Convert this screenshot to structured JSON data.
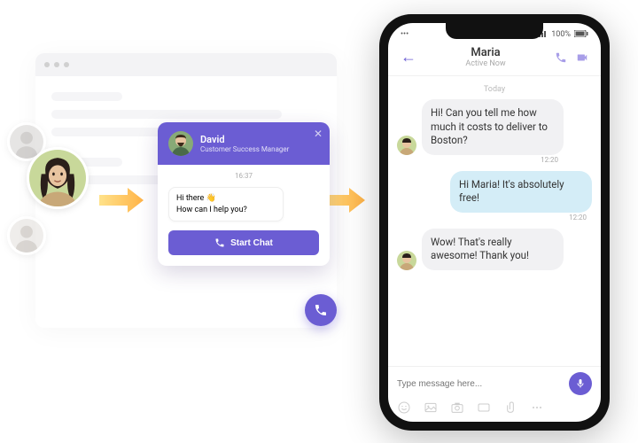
{
  "widget": {
    "agent_name": "David",
    "agent_title": "Customer Success Manager",
    "timestamp": "16:37",
    "greeting_line1": "Hi there 👋",
    "greeting_line2": "How can I help you?",
    "start_button": "Start Chat"
  },
  "phone": {
    "status_left": "•••",
    "status_signal": "📶",
    "status_battery": "100%",
    "contact_name": "Maria",
    "contact_status": "Active Now",
    "day_label": "Today",
    "messages": [
      {
        "dir": "in",
        "text": "Hi! Can you tell me how much it costs to deliver to Boston?",
        "time": "12:20"
      },
      {
        "dir": "out",
        "text": "Hi Maria! It's absolutely free!",
        "time": "12:20"
      },
      {
        "dir": "in",
        "text": "Wow! That's really awesome! Thank you!",
        "time": ""
      }
    ],
    "input_placeholder": "Type message here..."
  }
}
